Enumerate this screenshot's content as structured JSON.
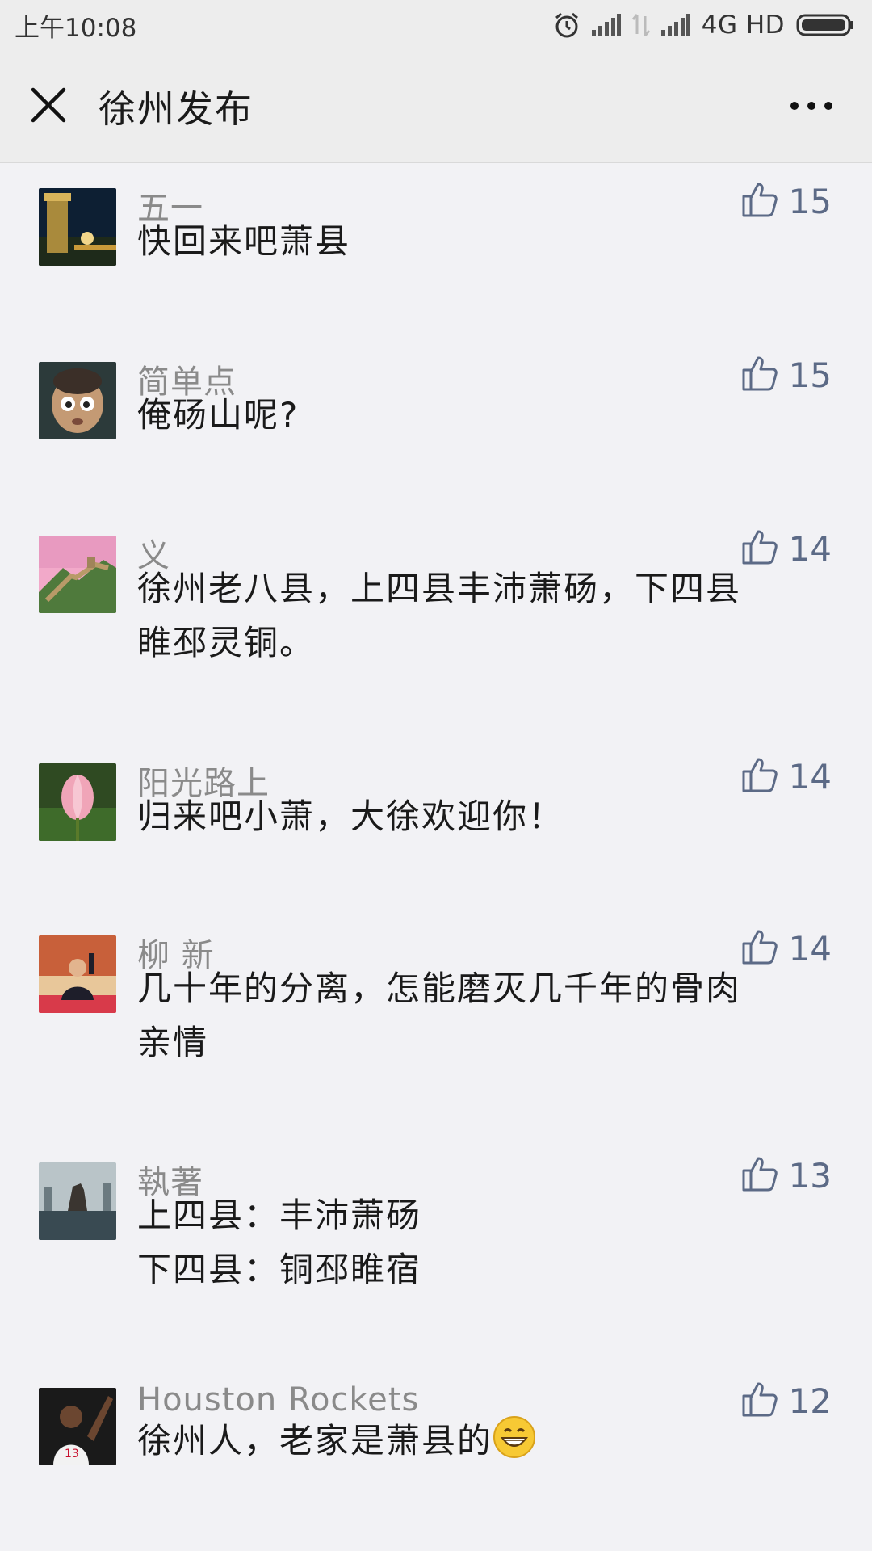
{
  "status_bar": {
    "time": "上午10:08",
    "network": "4G HD"
  },
  "header": {
    "title": "徐州发布"
  },
  "comments": [
    {
      "nickname": "五一",
      "text": "快回来吧萧县",
      "likes": "15"
    },
    {
      "nickname": "简单点",
      "text": "俺砀山呢?",
      "likes": "15"
    },
    {
      "nickname": "义",
      "text_lines": [
        "徐州老八县，上四县丰沛萧砀，下四县",
        "睢邳灵铜。"
      ],
      "likes": "14"
    },
    {
      "nickname": "阳光路上",
      "text": "归来吧小萧，大徐欢迎你！",
      "likes": "14"
    },
    {
      "nickname": "柳 新",
      "text_lines": [
        "几十年的分离，怎能磨灭几千年的骨肉",
        "亲情"
      ],
      "likes": "14"
    },
    {
      "nickname": "執著",
      "text_lines": [
        "上四县：丰沛萧砀",
        "下四县：铜邳睢宿"
      ],
      "likes": "13"
    },
    {
      "nickname": "Houston Rockets",
      "text": "徐州人，老家是萧县的",
      "likes": "12"
    }
  ],
  "colors": {
    "background": "#f2f2f5",
    "header_bg": "#ededed",
    "nickname": "#8a8a8a",
    "like": "#5c6a86"
  }
}
